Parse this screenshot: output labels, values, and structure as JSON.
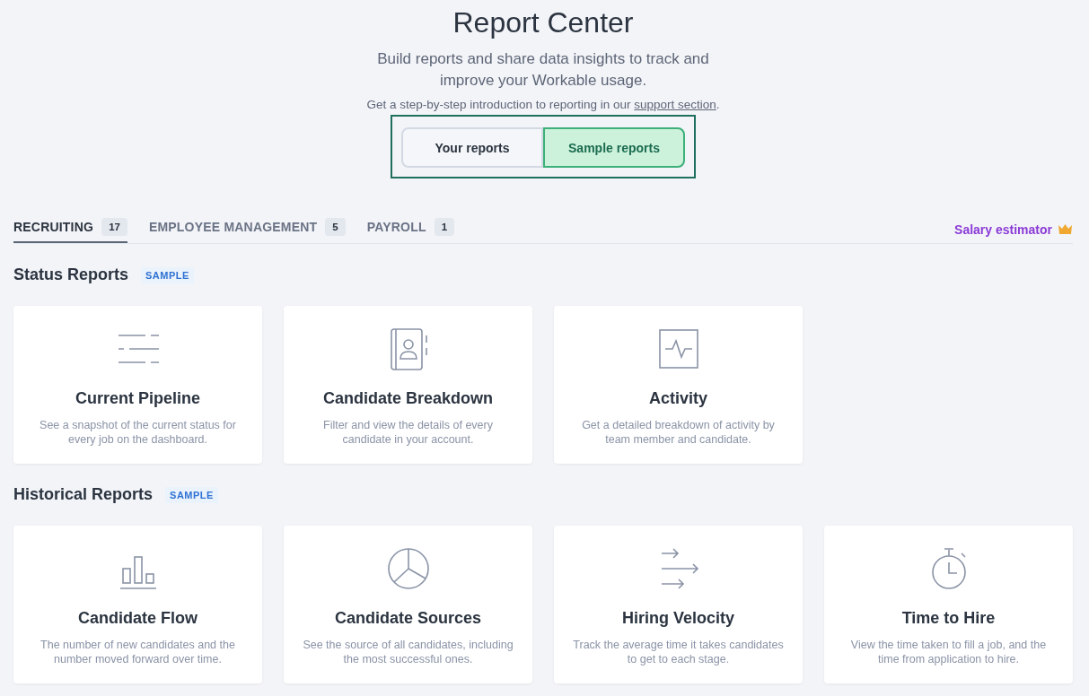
{
  "header": {
    "title": "Report Center",
    "subtitle": "Build reports and share data insights to track and improve your Workable usage.",
    "intro": {
      "before": "Get a step-by-step introduction to reporting in our ",
      "link": "support section",
      "after": "."
    }
  },
  "toggle": [
    {
      "label": "Your reports",
      "selected": false
    },
    {
      "label": "Sample reports",
      "selected": true
    }
  ],
  "tabs": [
    {
      "label": "RECRUITING",
      "count": "17",
      "selected": true
    },
    {
      "label": "EMPLOYEE MANAGEMENT",
      "count": "5",
      "selected": false
    },
    {
      "label": "PAYROLL",
      "count": "1",
      "selected": false
    }
  ],
  "salary_link": "Salary estimator",
  "sections": [
    {
      "title": "Status Reports",
      "badge": "SAMPLE",
      "cards": [
        {
          "kind": "lines",
          "title": "Current Pipeline",
          "description": "See a snapshot of the current status for every job on the dashboard."
        },
        {
          "kind": "contacts",
          "title": "Candidate Breakdown",
          "description": "Filter and view the details of every candidate in your account."
        },
        {
          "kind": "pulse",
          "title": "Activity",
          "description": "Get a detailed breakdown of activity by team member and candidate."
        }
      ]
    },
    {
      "title": "Historical Reports",
      "badge": "SAMPLE",
      "cards": [
        {
          "kind": "bars",
          "title": "Candidate Flow",
          "description": "The number of new candidates and the number moved forward over time."
        },
        {
          "kind": "pie",
          "title": "Candidate Sources",
          "description": "See the source of all candidates, including the most successful ones."
        },
        {
          "kind": "arrows",
          "title": "Hiring Velocity",
          "description": "Track the average time it takes candidates to get to each stage."
        },
        {
          "kind": "timer",
          "title": "Time to Hire",
          "description": "View the time taken to fill a job, and the time from application to hire."
        }
      ]
    }
  ]
}
